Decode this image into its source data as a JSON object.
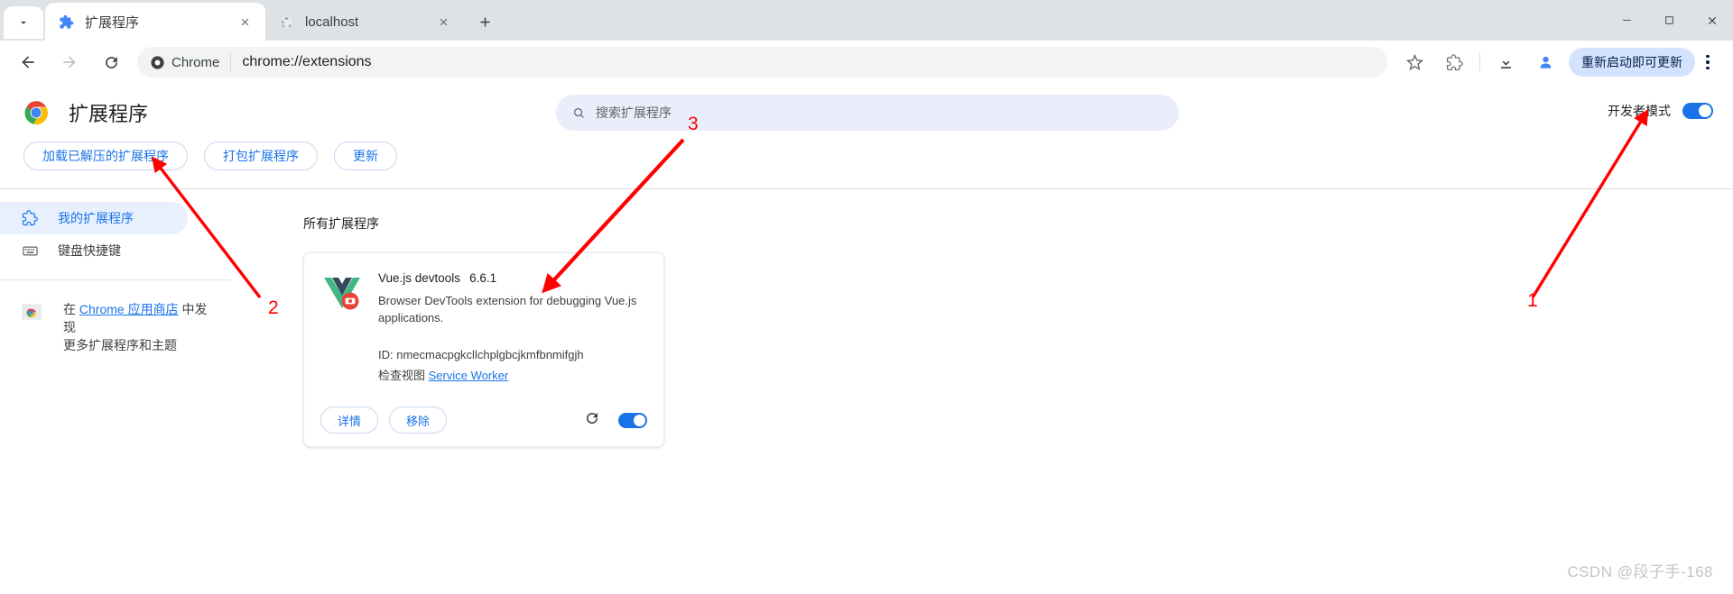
{
  "browser": {
    "tabs": [
      {
        "title": "扩展程序",
        "favicon": "puzzle-icon",
        "active": true
      },
      {
        "title": "localhost",
        "favicon": "globe-icon",
        "active": false
      }
    ],
    "tab_search_label": "搜索标签页",
    "new_tab_label": "新建标签页",
    "window_controls": {
      "minimize": "最小化",
      "maximize": "最大化",
      "close": "关闭"
    },
    "toolbar": {
      "back": "返回",
      "forward": "前进",
      "reload": "重新加载",
      "chrome_chip": "Chrome",
      "url": "chrome://extensions",
      "bookmark": "收藏此标签页",
      "extensions": "扩展程序",
      "downloads": "下载内容",
      "profile": "个人资料",
      "update_button": "重新启动即可更新",
      "menu": "自定义及控制 Google Chrome"
    }
  },
  "page": {
    "title": "扩展程序",
    "search": {
      "placeholder": "搜索扩展程序",
      "value": ""
    },
    "dev_mode": {
      "label": "开发者模式",
      "enabled": true
    },
    "actions": [
      {
        "label": "加载已解压的扩展程序"
      },
      {
        "label": "打包扩展程序"
      },
      {
        "label": "更新"
      }
    ],
    "sidebar": {
      "items": [
        {
          "label": "我的扩展程序",
          "icon": "puzzle-icon",
          "selected": true
        },
        {
          "label": "键盘快捷键",
          "icon": "keyboard-icon",
          "selected": false
        }
      ],
      "store": {
        "prefix": "在 ",
        "link": "Chrome 应用商店",
        "suffix": " 中发现",
        "line2": "更多扩展程序和主题"
      }
    },
    "content": {
      "section_title": "所有扩展程序",
      "extensions": [
        {
          "name": "Vue.js devtools",
          "version": "6.6.1",
          "description": "Browser DevTools extension for debugging Vue.js applications.",
          "id_label": "ID:",
          "id_value": "nmecmacpgkcllchplgbcjkmfbnmifgjh",
          "inspect_label": "检查视图",
          "inspect_link": "Service Worker",
          "details_button": "详情",
          "remove_button": "移除",
          "reload_label": "重新加载",
          "enabled": true
        }
      ]
    }
  },
  "annotations": [
    {
      "number": "1",
      "target": "开发者模式"
    },
    {
      "number": "2",
      "target": "加载已解压的扩展程序"
    },
    {
      "number": "3",
      "target": "Vue.js devtools"
    }
  ],
  "watermark": "CSDN @段子手-168",
  "colors": {
    "accent": "#1a73e8",
    "tabstrip": "#dee1e6",
    "annotation": "#ff0000",
    "search_bg": "#eaeefb",
    "update_chip": "#d3e3fd"
  }
}
